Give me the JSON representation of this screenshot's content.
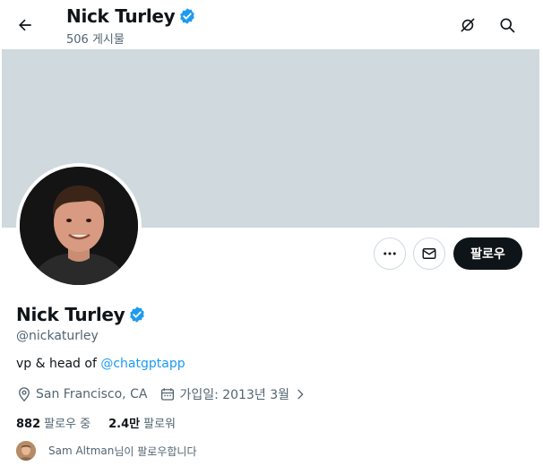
{
  "header": {
    "name": "Nick Turley",
    "post_count": "506 게시물",
    "icons": [
      "back-arrow-icon",
      "verified-badge-icon",
      "hide-icon",
      "search-icon"
    ]
  },
  "profile": {
    "name": "Nick Turley",
    "handle": "@nickaturley",
    "bio_prefix": "vp & head of ",
    "bio_link": "@chatgptapp",
    "location": "San Francisco, CA",
    "joined": "가입일: 2013년 3월",
    "following_count": "882",
    "following_label": "팔로우 중",
    "followers_count": "2.4만",
    "followers_label": "팔로워",
    "followed_by_name": "Sam Altman",
    "followed_by_suffix": " 님이 팔로우합니다"
  },
  "actions": {
    "more_icon": "more-dots-icon",
    "message_icon": "mail-icon",
    "follow_label": "팔로우"
  },
  "colors": {
    "banner": "#cfd9de",
    "verified": "#1d9bf0",
    "link": "#1d9bf0",
    "follow_button": "#0f1419",
    "secondary_text": "#536471"
  }
}
